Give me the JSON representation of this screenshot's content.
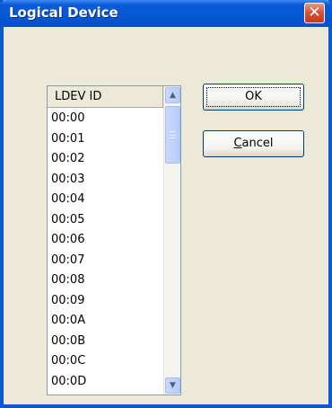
{
  "window": {
    "title": "Logical Device",
    "close_glyph": "✕"
  },
  "list": {
    "header": "LDEV ID",
    "items": [
      "00:00",
      "00:01",
      "00:02",
      "00:03",
      "00:04",
      "00:05",
      "00:06",
      "00:07",
      "00:08",
      "00:09",
      "00:0A",
      "00:0B",
      "00:0C",
      "00:0D"
    ]
  },
  "scrollbar": {
    "up_icon": "▲",
    "down_icon": "▼"
  },
  "buttons": {
    "ok": "OK",
    "cancel": "Cancel"
  },
  "colors": {
    "titlebar": "#0558d4",
    "dialog_bg": "#ece9d8",
    "close_button": "#d6553a"
  }
}
